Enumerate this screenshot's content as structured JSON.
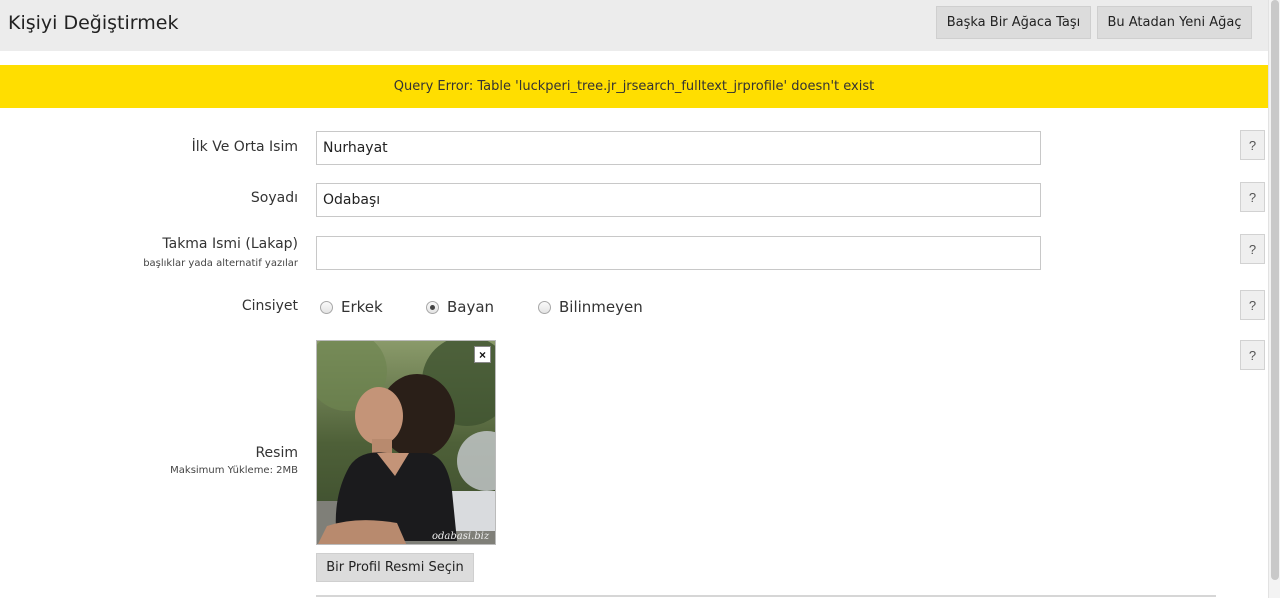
{
  "header": {
    "title": "Kişiyi Değiştirmek",
    "move_button": "Başka Bir Ağaca Taşı",
    "new_tree_button": "Bu Atadan Yeni Ağaç"
  },
  "error": {
    "message": "Query Error: Table 'luckperi_tree.jr_jrsearch_fulltext_jrprofile' doesn't exist"
  },
  "form": {
    "first_name": {
      "label": "İlk Ve Orta Isim",
      "value": "Nurhayat"
    },
    "surname": {
      "label": "Soyadı",
      "value": "Odabaşı"
    },
    "nickname": {
      "label": "Takma Ismi (Lakap)",
      "sublabel": "başlıklar yada alternatif yazılar",
      "value": ""
    },
    "gender": {
      "label": "Cinsiyet",
      "options": [
        "Erkek",
        "Bayan",
        "Bilinmeyen"
      ],
      "selected": "Bayan"
    },
    "photo": {
      "label": "Resim",
      "sublabel": "Maksimum Yükleme: 2MB",
      "watermark": "odabasi.biz",
      "close_glyph": "×",
      "choose_button": "Bir Profil Resmi Seçin"
    },
    "help_glyph": "?"
  }
}
